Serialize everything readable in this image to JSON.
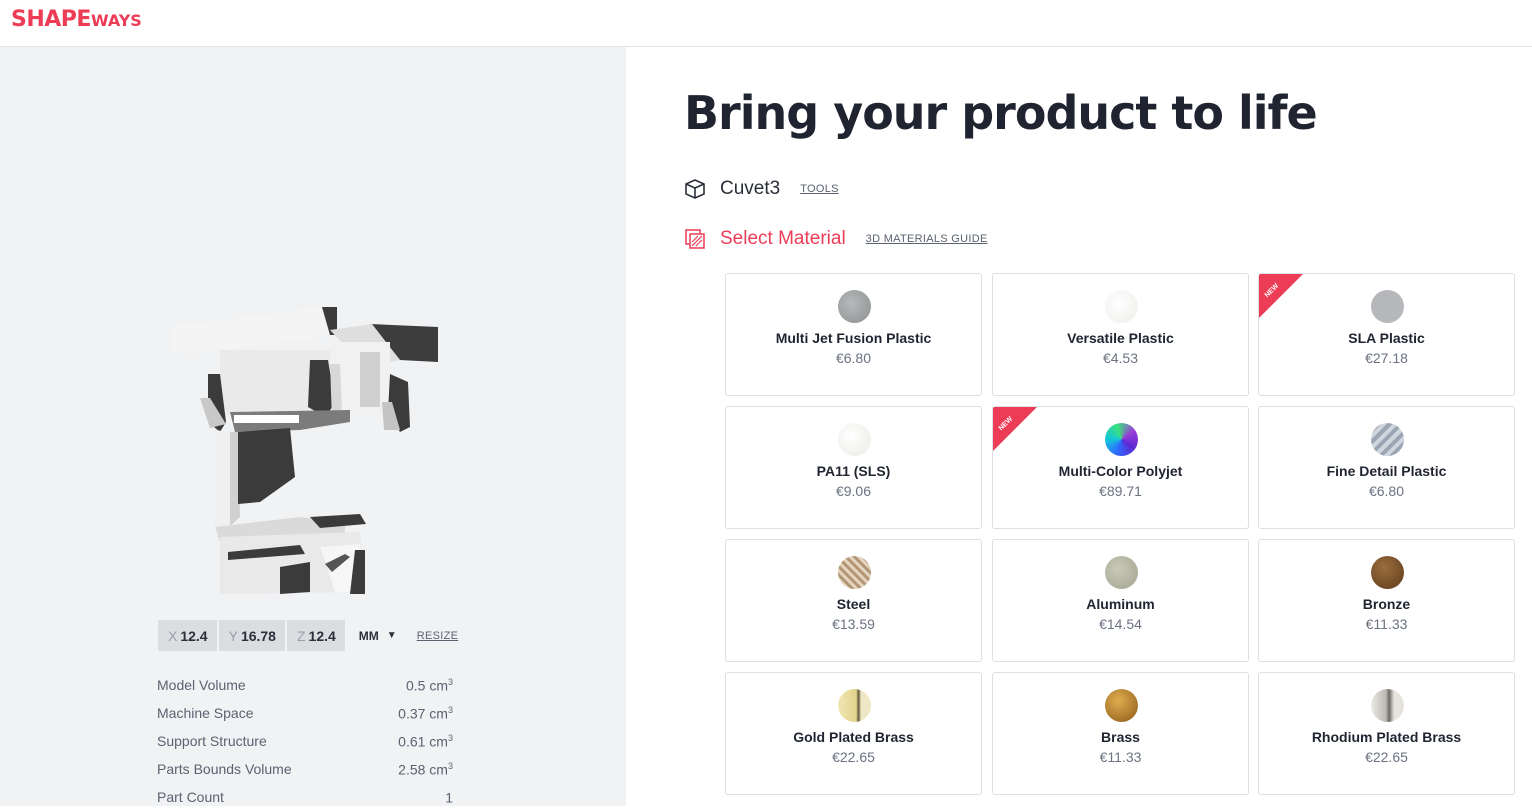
{
  "header": {
    "logo_main": "SHAPE",
    "logo_sub": "WAYS"
  },
  "viewer": {
    "dims": [
      {
        "axis": "X",
        "value": "12.4"
      },
      {
        "axis": "Y",
        "value": "16.78"
      },
      {
        "axis": "Z",
        "value": "12.4"
      }
    ],
    "unit": "MM",
    "resize_label": "RESIZE",
    "stats": [
      {
        "label": "Model Volume",
        "value": "0.5 cm",
        "sup": "3"
      },
      {
        "label": "Machine Space",
        "value": "0.37 cm",
        "sup": "3"
      },
      {
        "label": "Support Structure",
        "value": "0.61 cm",
        "sup": "3"
      },
      {
        "label": "Parts Bounds Volume",
        "value": "2.58 cm",
        "sup": "3"
      },
      {
        "label": "Part Count",
        "value": "1",
        "sup": ""
      }
    ]
  },
  "main": {
    "title": "Bring your product to life",
    "model_name": "Cuvet3",
    "tools_label": "TOOLS",
    "select_material_label": "Select Material",
    "guide_label": "3D MATERIALS GUIDE",
    "ribbon_text": "NEW",
    "colors": {
      "accent": "#ed3c55",
      "ribbon": "#ed3c55"
    },
    "materials": [
      {
        "name": "Multi Jet Fusion Plastic",
        "price": "€6.80",
        "swatch": "radial-gradient(circle at 40% 40%, #b6b8b9, #8d9091)",
        "new": false
      },
      {
        "name": "Versatile Plastic",
        "price": "€4.53",
        "swatch": "radial-gradient(circle at 40% 40%, #ffffff, #eceee9)",
        "new": false
      },
      {
        "name": "SLA Plastic",
        "price": "€27.18",
        "swatch": "#b5b7ba",
        "new": true
      },
      {
        "name": "PA11 (SLS)",
        "price": "€9.06",
        "swatch": "radial-gradient(circle at 40% 40%, #ffffff, #e9ebe5)",
        "new": false
      },
      {
        "name": "Multi-Color Polyjet",
        "price": "€89.71",
        "swatch": "conic-gradient(from 200deg, #2b6cff, #16c6d8, #3ae07d, #9b3bd9, #5a2bd4, #2b6cff)",
        "new": true
      },
      {
        "name": "Fine Detail Plastic",
        "price": "€6.80",
        "swatch": "repeating-linear-gradient(135deg, #cfd6de 0 4px, #9aa6b3 4px 8px)",
        "new": false
      },
      {
        "name": "Steel",
        "price": "€13.59",
        "swatch": "repeating-linear-gradient(45deg, #e3d3bd 0 3px, #b09474 3px 6px)",
        "new": false
      },
      {
        "name": "Aluminum",
        "price": "€14.54",
        "swatch": "radial-gradient(circle at 40% 40%, #c8c9b7, #a2a48f)",
        "new": false
      },
      {
        "name": "Bronze",
        "price": "€11.33",
        "swatch": "radial-gradient(circle at 40% 35%, #9b6d3f, #5e3c1a)",
        "new": false
      },
      {
        "name": "Gold Plated Brass",
        "price": "€22.65",
        "swatch": "linear-gradient(90deg, #f1e7b5 0%, #e2d38c 55%, #5d5538 62%, #efe6c4 70%)",
        "new": false
      },
      {
        "name": "Brass",
        "price": "€11.33",
        "swatch": "radial-gradient(circle at 40% 35%, #e0ad4f, #8a5a18)",
        "new": false
      },
      {
        "name": "Rhodium Plated Brass",
        "price": "€22.65",
        "swatch": "linear-gradient(90deg, #eceae6 0%, #bdb9b1 45%, #6d6a66 55%, #e6e3de 70%)",
        "new": false
      }
    ]
  }
}
